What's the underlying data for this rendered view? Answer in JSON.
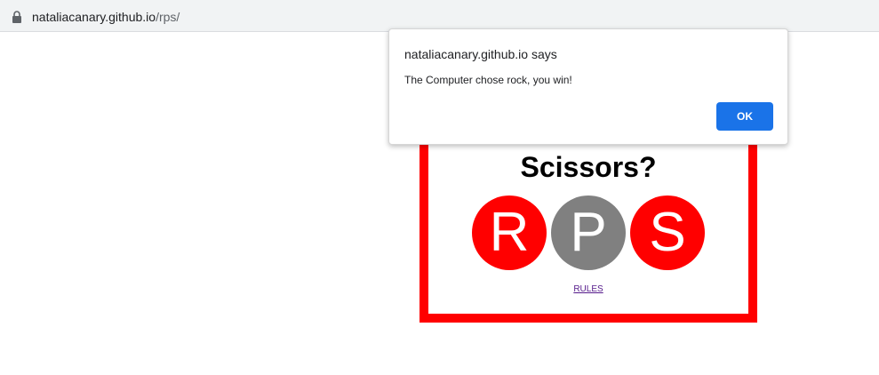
{
  "browser": {
    "url_host": "nataliacanary.github.io",
    "url_path": "/rps/",
    "lock_icon": "lock-icon"
  },
  "game": {
    "title": "Scissors?",
    "border_color": "#ff0000",
    "choices": [
      {
        "label": "R",
        "color": "#ff0000"
      },
      {
        "label": "P",
        "color": "#808080"
      },
      {
        "label": "S",
        "color": "#ff0000"
      }
    ],
    "rules_link": "RULES"
  },
  "dialog": {
    "title": "nataliacanary.github.io says",
    "message": "The Computer chose rock, you win!",
    "ok_label": "OK",
    "ok_color": "#1a73e8"
  }
}
